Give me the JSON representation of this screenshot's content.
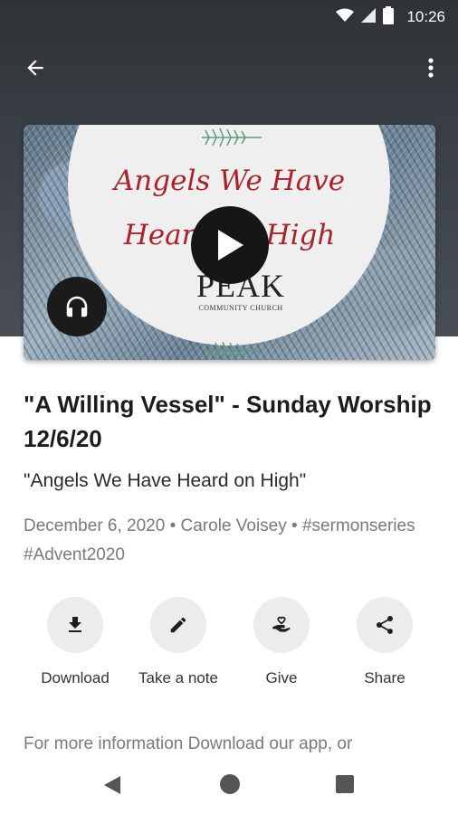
{
  "status_bar": {
    "time": "10:26"
  },
  "artwork": {
    "line1": "Angels We Have",
    "line2": "Heard on High",
    "logo_title": "PEAK",
    "logo_subtitle": "COMMUNITY CHURCH"
  },
  "sermon": {
    "title": "\"A Willing Vessel\" - Sunday Worship 12/6/20",
    "subtitle": "\"Angels We Have Heard on High\"",
    "meta": "December 6, 2020 • Carole Voisey • #sermonseries #Advent2020"
  },
  "actions": [
    {
      "label": "Download",
      "icon": "download-icon"
    },
    {
      "label": "Take a note",
      "icon": "pencil-icon"
    },
    {
      "label": "Give",
      "icon": "give-hand-heart-icon"
    },
    {
      "label": "Share",
      "icon": "share-icon"
    }
  ],
  "more_info": "For more information Download our app, or",
  "colors": {
    "header": "#3b4046",
    "artwork_text": "#a8232a",
    "action_circle": "#ececec"
  }
}
